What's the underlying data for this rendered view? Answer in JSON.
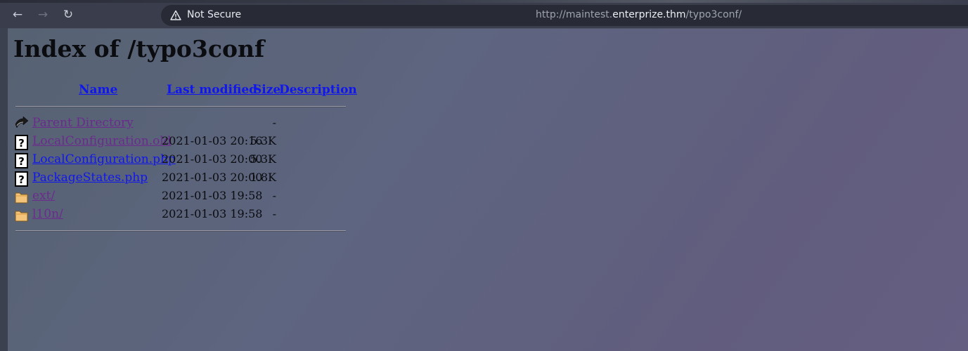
{
  "browser": {
    "security_label": "Not Secure",
    "url": {
      "prefix": "http://maintest.",
      "host": "enterprize.thm",
      "path": "/typo3conf/"
    },
    "icons": {
      "back": "back-arrow-icon",
      "forward": "forward-arrow-icon",
      "reload": "reload-icon",
      "security": "warning-triangle-icon"
    }
  },
  "page": {
    "title": "Index of /typo3conf",
    "columns": {
      "name": "Name",
      "last_modified": "Last modified",
      "size": "Size",
      "description": "Description"
    },
    "entries": [
      {
        "icon": "back-icon",
        "name": "Parent Directory",
        "modified": "",
        "size": "-",
        "visited": true
      },
      {
        "icon": "unknown-file-icon",
        "name": "LocalConfiguration.old",
        "modified": "2021-01-03 20:16",
        "size": "5.3K",
        "visited": true
      },
      {
        "icon": "unknown-file-icon",
        "name": "LocalConfiguration.php",
        "modified": "2021-01-03 20:00",
        "size": "5.3K",
        "visited": false
      },
      {
        "icon": "unknown-file-icon",
        "name": "PackageStates.php",
        "modified": "2021-01-03 20:00",
        "size": "1.8K",
        "visited": false
      },
      {
        "icon": "folder-icon",
        "name": "ext/",
        "modified": "2021-01-03 19:58",
        "size": "-",
        "visited": true
      },
      {
        "icon": "folder-icon",
        "name": "l10n/",
        "modified": "2021-01-03 19:58",
        "size": "-",
        "visited": true
      }
    ]
  },
  "colors": {
    "link": "#1016ee",
    "visited_link": "#6a2b8c",
    "text": "#0b0c10"
  }
}
